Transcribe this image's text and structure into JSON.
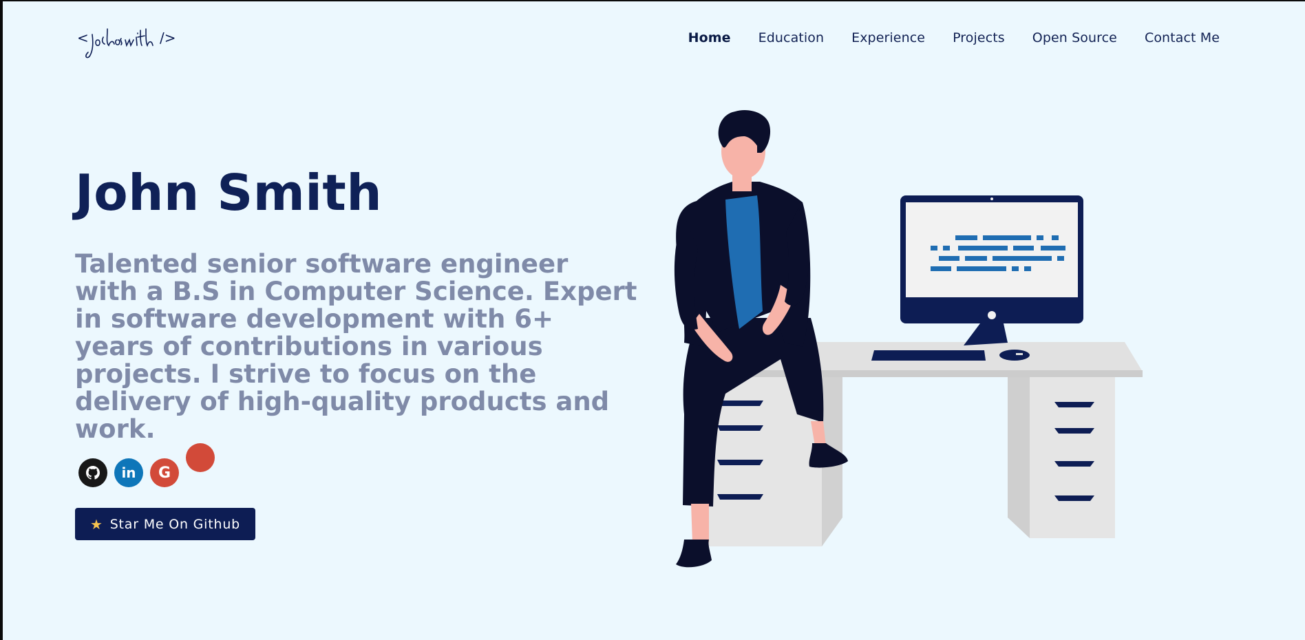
{
  "header": {
    "logo_text": "< johnsmith />",
    "nav": [
      {
        "label": "Home",
        "active": true
      },
      {
        "label": "Education"
      },
      {
        "label": "Experience"
      },
      {
        "label": "Projects"
      },
      {
        "label": "Open Source"
      },
      {
        "label": "Contact Me"
      }
    ]
  },
  "hero": {
    "name": "John Smith",
    "bio": "Talented senior software engineer with a B.S in Computer Science. Expert in software development with 6+ years of contributions in various projects. I strive to focus on the delivery of high-quality products and work.",
    "socials": [
      {
        "name": "github",
        "glyph": "",
        "color": "#181818"
      },
      {
        "name": "linkedin",
        "glyph": "in",
        "color": "#0e76b9"
      },
      {
        "name": "google",
        "glyph": "G",
        "color": "#d24a39"
      }
    ],
    "cta": {
      "icon": "★",
      "label": "Star Me On Github"
    }
  },
  "colors": {
    "background": "#ecf8fe",
    "primary": "#0d1d54",
    "muted_text": "#7f8aa8",
    "accent_blue": "#0e6fab"
  }
}
